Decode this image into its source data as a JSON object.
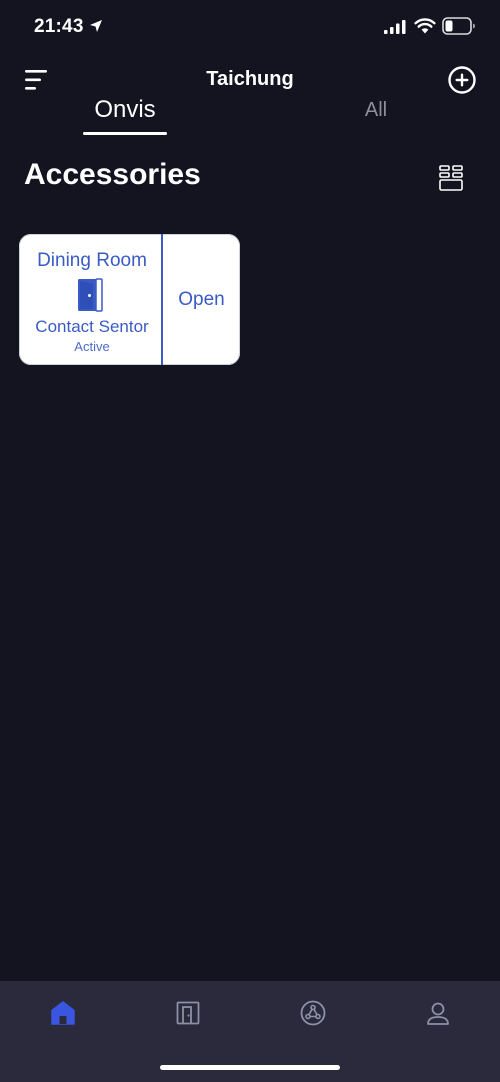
{
  "status_bar": {
    "time": "21:43",
    "icons": [
      "location-arrow-icon",
      "cellular-signal-icon",
      "wifi-icon",
      "battery-icon"
    ]
  },
  "header": {
    "title": "Taichung",
    "menu_icon": "menu-icon",
    "add_icon": "plus-circle-icon"
  },
  "tabs": [
    {
      "label": "Onvis",
      "selected": true
    },
    {
      "label": "All",
      "selected": false
    }
  ],
  "section": {
    "title": "Accessories",
    "layout_icon": "layout-toggle-icon"
  },
  "accessories": [
    {
      "room": "Dining Room",
      "name": "Contact Sentor",
      "status": "Active",
      "state": "Open",
      "icon": "door-icon"
    }
  ],
  "bottom_nav": [
    {
      "icon": "home-icon",
      "selected": true
    },
    {
      "icon": "door-icon",
      "selected": false
    },
    {
      "icon": "automation-icon",
      "selected": false
    },
    {
      "icon": "profile-icon",
      "selected": false
    }
  ],
  "colors": {
    "background": "#141421",
    "card_background": "#ffffff",
    "accent": "#3b5cc4",
    "bottom_bar": "#2a2a3c",
    "active_nav": "#3a56e0",
    "inactive_nav": "#8f8fa6"
  }
}
